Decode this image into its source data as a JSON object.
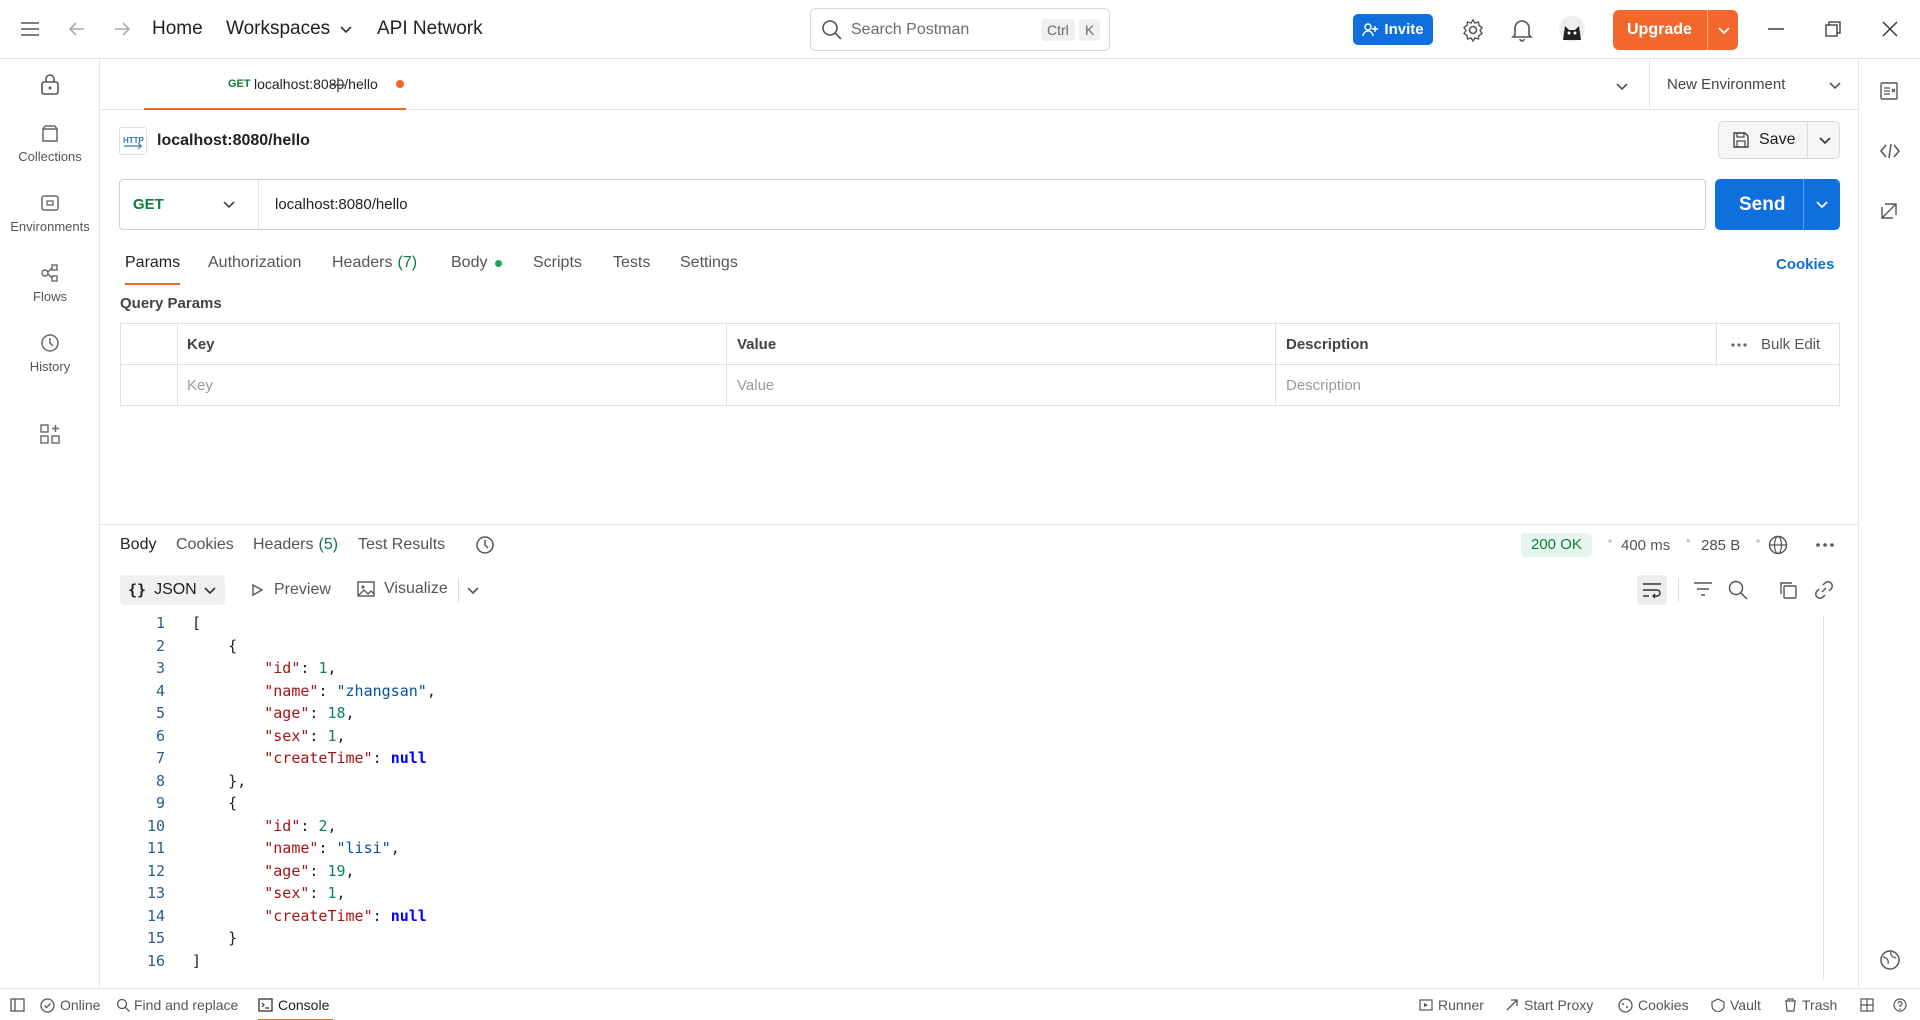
{
  "topbar": {
    "home": "Home",
    "workspaces": "Workspaces",
    "api_network": "API Network",
    "search_placeholder": "Search Postman",
    "kbd_ctrl": "Ctrl",
    "kbd_k": "K",
    "invite": "Invite",
    "upgrade": "Upgrade"
  },
  "sidebar": {
    "items": [
      {
        "label": "Collections",
        "icon": "collections-icon"
      },
      {
        "label": "Environments",
        "icon": "environments-icon"
      },
      {
        "label": "Flows",
        "icon": "flows-icon"
      },
      {
        "label": "History",
        "icon": "history-icon"
      }
    ]
  },
  "tabs": {
    "active": {
      "method": "GET",
      "title": "localhost:8080/hello"
    },
    "environment": "New Environment"
  },
  "request": {
    "name": "localhost:8080/hello",
    "save": "Save",
    "method": "GET",
    "url": "localhost:8080/hello",
    "send": "Send",
    "subtabs": [
      "Params",
      "Authorization",
      "Headers",
      "Body",
      "Scripts",
      "Tests",
      "Settings"
    ],
    "headers_count": "(7)",
    "cookies": "Cookies",
    "query_params_title": "Query Params",
    "table": {
      "headers": [
        "Key",
        "Value",
        "Description"
      ],
      "bulk_edit": "Bulk Edit",
      "placeholders": [
        "Key",
        "Value",
        "Description"
      ]
    }
  },
  "response": {
    "tabs": [
      "Body",
      "Cookies",
      "Headers",
      "Test Results"
    ],
    "headers_count": "(5)",
    "status": "200 OK",
    "time": "400 ms",
    "size": "285 B",
    "format": "JSON",
    "preview": "Preview",
    "visualize": "Visualize",
    "lines": [
      "1",
      "2",
      "3",
      "4",
      "5",
      "6",
      "7",
      "8",
      "9",
      "10",
      "11",
      "12",
      "13",
      "14",
      "15",
      "16"
    ]
  },
  "statusbar": {
    "online": "Online",
    "find_replace": "Find and replace",
    "console": "Console",
    "runner": "Runner",
    "start_proxy": "Start Proxy",
    "cookies": "Cookies",
    "vault": "Vault",
    "trash": "Trash"
  },
  "colors": {
    "accent": "#f1672c",
    "primary": "#0f6fdd",
    "get": "#0f7b3f",
    "success_bg": "#e7f6ec",
    "success_text": "#0f7b3f"
  }
}
